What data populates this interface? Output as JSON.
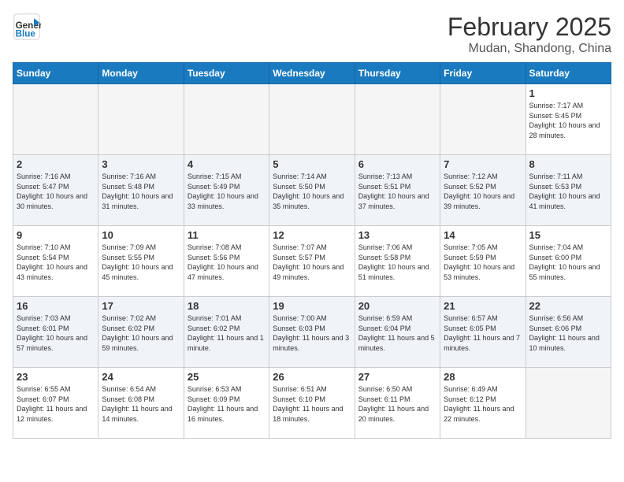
{
  "header": {
    "logo_line1": "General",
    "logo_line2": "Blue",
    "title": "February 2025",
    "subtitle": "Mudan, Shandong, China"
  },
  "weekdays": [
    "Sunday",
    "Monday",
    "Tuesday",
    "Wednesday",
    "Thursday",
    "Friday",
    "Saturday"
  ],
  "weeks": [
    [
      {
        "day": "",
        "info": ""
      },
      {
        "day": "",
        "info": ""
      },
      {
        "day": "",
        "info": ""
      },
      {
        "day": "",
        "info": ""
      },
      {
        "day": "",
        "info": ""
      },
      {
        "day": "",
        "info": ""
      },
      {
        "day": "1",
        "info": "Sunrise: 7:17 AM\nSunset: 5:45 PM\nDaylight: 10 hours and 28 minutes."
      }
    ],
    [
      {
        "day": "2",
        "info": "Sunrise: 7:16 AM\nSunset: 5:47 PM\nDaylight: 10 hours and 30 minutes."
      },
      {
        "day": "3",
        "info": "Sunrise: 7:16 AM\nSunset: 5:48 PM\nDaylight: 10 hours and 31 minutes."
      },
      {
        "day": "4",
        "info": "Sunrise: 7:15 AM\nSunset: 5:49 PM\nDaylight: 10 hours and 33 minutes."
      },
      {
        "day": "5",
        "info": "Sunrise: 7:14 AM\nSunset: 5:50 PM\nDaylight: 10 hours and 35 minutes."
      },
      {
        "day": "6",
        "info": "Sunrise: 7:13 AM\nSunset: 5:51 PM\nDaylight: 10 hours and 37 minutes."
      },
      {
        "day": "7",
        "info": "Sunrise: 7:12 AM\nSunset: 5:52 PM\nDaylight: 10 hours and 39 minutes."
      },
      {
        "day": "8",
        "info": "Sunrise: 7:11 AM\nSunset: 5:53 PM\nDaylight: 10 hours and 41 minutes."
      }
    ],
    [
      {
        "day": "9",
        "info": "Sunrise: 7:10 AM\nSunset: 5:54 PM\nDaylight: 10 hours and 43 minutes."
      },
      {
        "day": "10",
        "info": "Sunrise: 7:09 AM\nSunset: 5:55 PM\nDaylight: 10 hours and 45 minutes."
      },
      {
        "day": "11",
        "info": "Sunrise: 7:08 AM\nSunset: 5:56 PM\nDaylight: 10 hours and 47 minutes."
      },
      {
        "day": "12",
        "info": "Sunrise: 7:07 AM\nSunset: 5:57 PM\nDaylight: 10 hours and 49 minutes."
      },
      {
        "day": "13",
        "info": "Sunrise: 7:06 AM\nSunset: 5:58 PM\nDaylight: 10 hours and 51 minutes."
      },
      {
        "day": "14",
        "info": "Sunrise: 7:05 AM\nSunset: 5:59 PM\nDaylight: 10 hours and 53 minutes."
      },
      {
        "day": "15",
        "info": "Sunrise: 7:04 AM\nSunset: 6:00 PM\nDaylight: 10 hours and 55 minutes."
      }
    ],
    [
      {
        "day": "16",
        "info": "Sunrise: 7:03 AM\nSunset: 6:01 PM\nDaylight: 10 hours and 57 minutes."
      },
      {
        "day": "17",
        "info": "Sunrise: 7:02 AM\nSunset: 6:02 PM\nDaylight: 10 hours and 59 minutes."
      },
      {
        "day": "18",
        "info": "Sunrise: 7:01 AM\nSunset: 6:02 PM\nDaylight: 11 hours and 1 minute."
      },
      {
        "day": "19",
        "info": "Sunrise: 7:00 AM\nSunset: 6:03 PM\nDaylight: 11 hours and 3 minutes."
      },
      {
        "day": "20",
        "info": "Sunrise: 6:59 AM\nSunset: 6:04 PM\nDaylight: 11 hours and 5 minutes."
      },
      {
        "day": "21",
        "info": "Sunrise: 6:57 AM\nSunset: 6:05 PM\nDaylight: 11 hours and 7 minutes."
      },
      {
        "day": "22",
        "info": "Sunrise: 6:56 AM\nSunset: 6:06 PM\nDaylight: 11 hours and 10 minutes."
      }
    ],
    [
      {
        "day": "23",
        "info": "Sunrise: 6:55 AM\nSunset: 6:07 PM\nDaylight: 11 hours and 12 minutes."
      },
      {
        "day": "24",
        "info": "Sunrise: 6:54 AM\nSunset: 6:08 PM\nDaylight: 11 hours and 14 minutes."
      },
      {
        "day": "25",
        "info": "Sunrise: 6:53 AM\nSunset: 6:09 PM\nDaylight: 11 hours and 16 minutes."
      },
      {
        "day": "26",
        "info": "Sunrise: 6:51 AM\nSunset: 6:10 PM\nDaylight: 11 hours and 18 minutes."
      },
      {
        "day": "27",
        "info": "Sunrise: 6:50 AM\nSunset: 6:11 PM\nDaylight: 11 hours and 20 minutes."
      },
      {
        "day": "28",
        "info": "Sunrise: 6:49 AM\nSunset: 6:12 PM\nDaylight: 11 hours and 22 minutes."
      },
      {
        "day": "",
        "info": ""
      }
    ]
  ]
}
